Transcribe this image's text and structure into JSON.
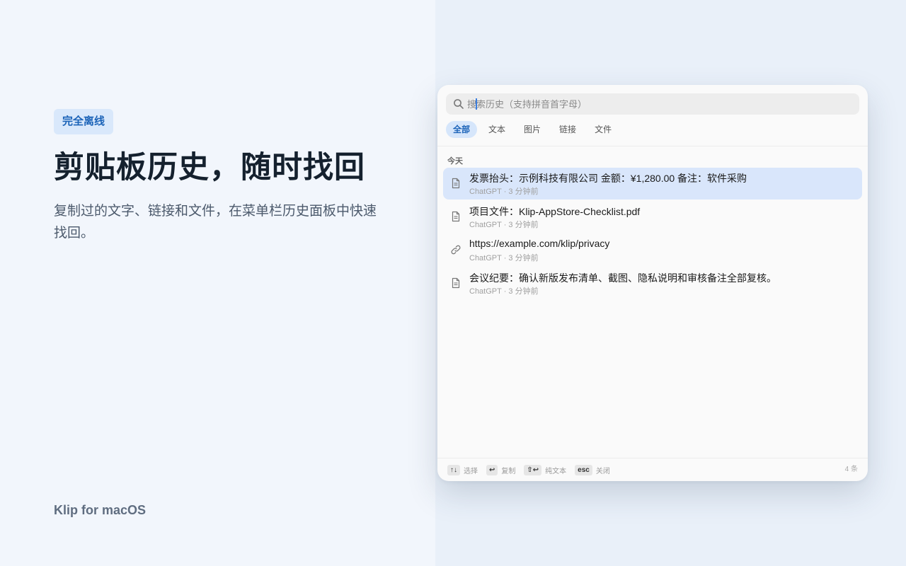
{
  "hero": {
    "badge": "完全离线",
    "headline": "剪贴板历史，随时找回",
    "subline": "复制过的文字、链接和文件，在菜单栏历史面板中快速找回。",
    "brand": "Klip for macOS"
  },
  "panel": {
    "search": {
      "placeholder": "搜索历史（支持拼音首字母）",
      "icon": "search-icon"
    },
    "filters": [
      "全部",
      "文本",
      "图片",
      "链接",
      "文件"
    ],
    "active_filter": "全部",
    "section_label": "今天",
    "items": [
      {
        "title": "发票抬头：示例科技有限公司 金额：¥1,280.00 备注：软件采购",
        "meta": "ChatGPT · 3 分钟前",
        "icon": "document-icon",
        "selected": true
      },
      {
        "title": "项目文件：Klip-AppStore-Checklist.pdf",
        "meta": "ChatGPT · 3 分钟前",
        "icon": "document-icon",
        "selected": false
      },
      {
        "title": "https://example.com/klip/privacy",
        "meta": "ChatGPT · 3 分钟前",
        "icon": "link-icon",
        "selected": false
      },
      {
        "title": "会议纪要：确认新版发布清单、截图、隐私说明和审核备注全部复核。",
        "meta": "ChatGPT · 3 分钟前",
        "icon": "document-icon",
        "selected": false
      }
    ],
    "footer": [
      {
        "key": "↑↓",
        "label": "选择"
      },
      {
        "key": "↩",
        "label": "复制"
      },
      {
        "key": "⇧↩",
        "label": "纯文本"
      },
      {
        "key": "esc",
        "label": "关闭"
      }
    ],
    "count": "4 条"
  },
  "colors": {
    "accent": "#1b63b8",
    "selected_row": "#d9e6fb",
    "badge_bg": "#d9e8fb"
  }
}
